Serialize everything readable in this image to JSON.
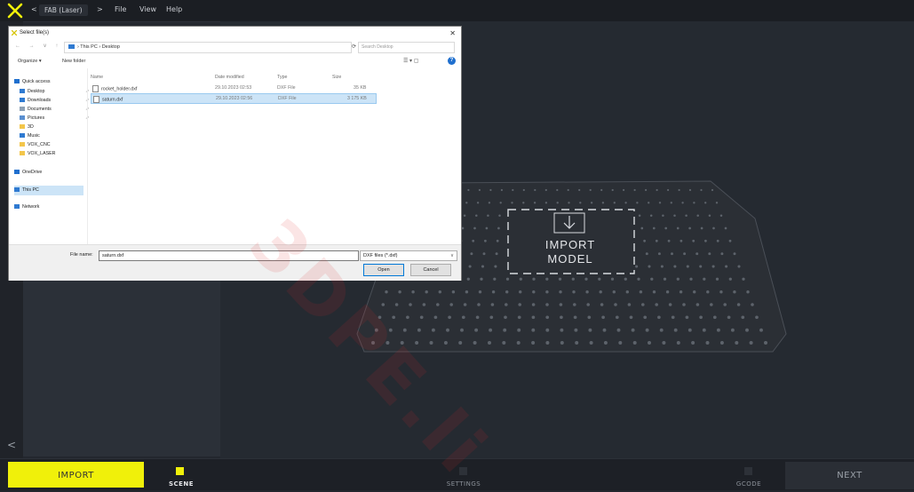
{
  "app": {
    "nav_back": "<",
    "mode": "FAB (Laser)",
    "nav_forward": ">",
    "menus": [
      "File",
      "View",
      "Help"
    ]
  },
  "viewport": {
    "import_model_line1": "IMPORT",
    "import_model_line2": "MODEL"
  },
  "bottom": {
    "import_label": "IMPORT",
    "next_label": "NEXT",
    "steps": [
      "SCENE",
      "SETTINGS",
      "GCODE"
    ],
    "active_step": "SCENE",
    "back_arrow": "<"
  },
  "dialog": {
    "title": "Select file(s)",
    "close": "✕",
    "path": "› This PC › Desktop",
    "search_placeholder": "Search Desktop",
    "organize": "Organize ▾",
    "new_folder": "New folder",
    "nav_items": [
      {
        "label": "Quick access",
        "icon": "star-icon",
        "pin": false
      },
      {
        "label": "Desktop",
        "icon": "desktop-icon",
        "pin": true
      },
      {
        "label": "Downloads",
        "icon": "download-icon",
        "pin": true
      },
      {
        "label": "Documents",
        "icon": "document-icon",
        "pin": true
      },
      {
        "label": "Pictures",
        "icon": "picture-icon",
        "pin": true
      },
      {
        "label": "3D",
        "icon": "folder-icon",
        "pin": false
      },
      {
        "label": "Music",
        "icon": "music-icon",
        "pin": false
      },
      {
        "label": "VOX_CNC",
        "icon": "folder-icon",
        "pin": false
      },
      {
        "label": "VOX_LASER",
        "icon": "folder-icon",
        "pin": false
      },
      {
        "label": "OneDrive",
        "icon": "cloud-icon",
        "pin": false
      },
      {
        "label": "This PC",
        "icon": "pc-icon",
        "pin": false
      },
      {
        "label": "Network",
        "icon": "network-icon",
        "pin": false
      }
    ],
    "columns": [
      "Name",
      "Date modified",
      "Type",
      "Size"
    ],
    "files": [
      {
        "name": "rocket_holder.dxf",
        "date": "29.10.2023 02:53",
        "type": "DXF File",
        "size": "35 KB",
        "selected": false
      },
      {
        "name": "saturn.dxf",
        "date": "29.10.2023 02:56",
        "type": "DXF File",
        "size": "3 175 KB",
        "selected": true
      }
    ],
    "file_name_label": "File name:",
    "file_name_value": "saturn.dxf",
    "file_type": "DXF files (*.dxf)",
    "open_label": "Open",
    "cancel_label": "Cancel"
  },
  "watermark": "3DPE.li"
}
